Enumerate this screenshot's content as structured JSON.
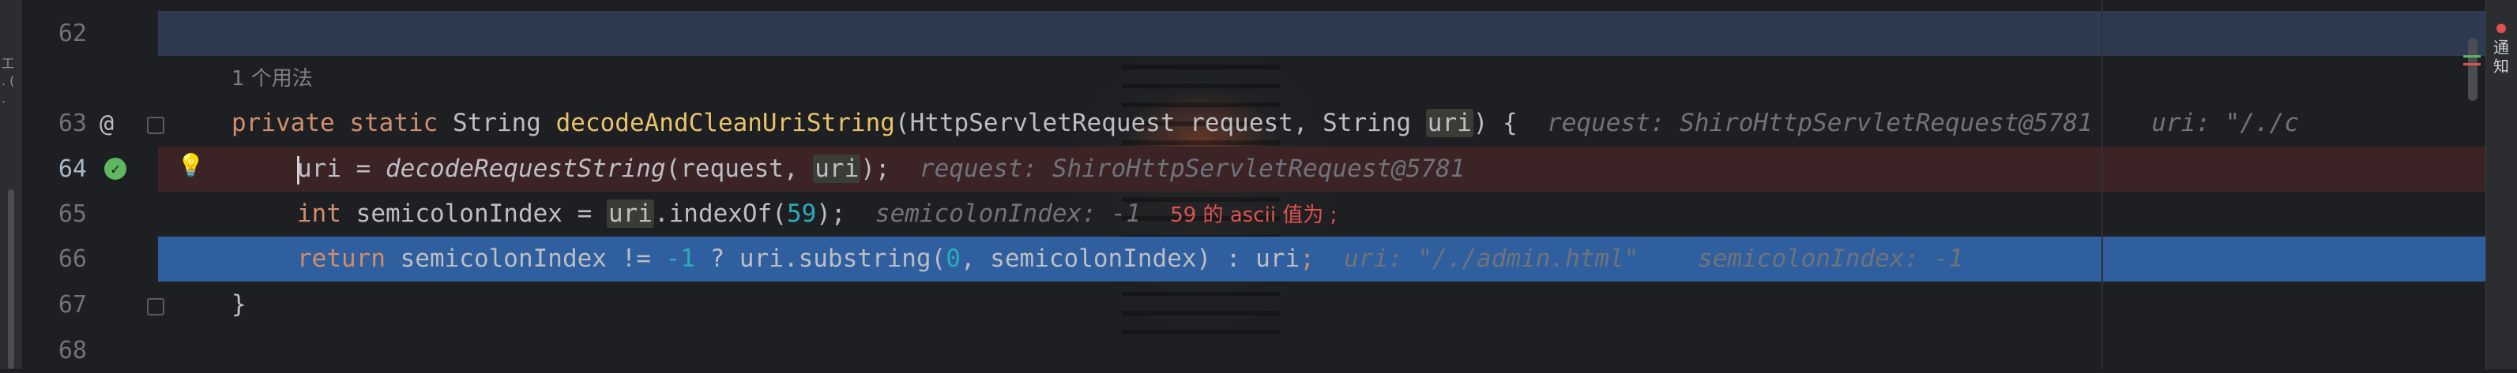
{
  "editor": {
    "lines": [
      {
        "number": "62"
      },
      {
        "number": "63"
      },
      {
        "number": "64"
      },
      {
        "number": "65"
      },
      {
        "number": "66"
      },
      {
        "number": "67"
      },
      {
        "number": "68"
      }
    ],
    "usage_label": "1 个用法",
    "line63": {
      "kw_private": "private",
      "kw_static": "static",
      "type_string": "String",
      "method_name": "decodeAndCleanUriString",
      "params_a": "(HttpServletRequest request, String ",
      "param_uri": "uri",
      "params_b": ") {",
      "hint_a": "request: ShiroHttpServletRequest@5781",
      "hint_b": "uri: \"/./c"
    },
    "line64": {
      "var": "uri",
      "assign": " = ",
      "call": "decodeRequestString",
      "args_a": "(request, ",
      "args_uri": "uri",
      "args_b": ");",
      "hint": "request: ShiroHttpServletRequest@5781"
    },
    "line65": {
      "kw_int": "int",
      "decl": " semicolonIndex = ",
      "recv": "uri",
      "call": ".indexOf(",
      "num": "59",
      "end": ");",
      "hint": "semicolonIndex: -1",
      "comment": "59 的 ascii 值为 ;"
    },
    "line66": {
      "kw_return": "return",
      "expr_a": " semicolonIndex != ",
      "num_neg": "-1",
      "expr_b": " ? ",
      "recv": "uri",
      "call": ".substring(",
      "num_zero": "0",
      "expr_c": ", semicolonIndex) : ",
      "uri2": "uri",
      "end": ";",
      "hint_a": "uri: \"/./admin.html\"",
      "hint_b": "semicolonIndex: -1"
    },
    "line67": {
      "brace": "}"
    }
  },
  "left_panel": {
    "vertical_text": "工 . ( ."
  },
  "right_panel": {
    "notification_label": "通知"
  },
  "colors": {
    "keyword": "#cf8e6d",
    "method_decl": "#e8c36a",
    "number": "#2aacb8",
    "hint": "#6f737a",
    "current_line": "#2f5f9e",
    "breakpoint_line": "#3b2326"
  }
}
